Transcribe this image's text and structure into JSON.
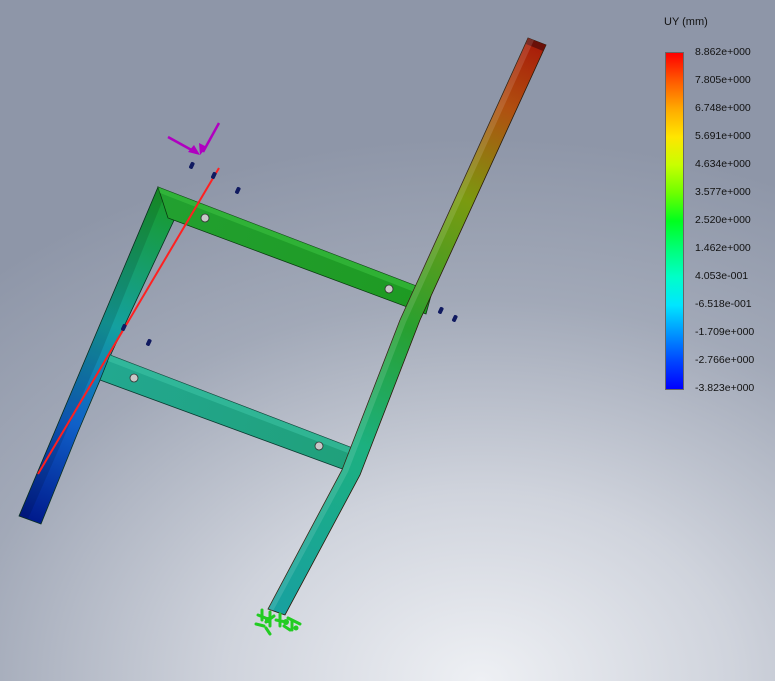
{
  "legend": {
    "title": "UY (mm)",
    "labels": [
      "8.862e+000",
      "7.805e+000",
      "6.748e+000",
      "5.691e+000",
      "4.634e+000",
      "3.577e+000",
      "2.520e+000",
      "1.462e+000",
      "4.053e-001",
      "-6.518e-001",
      "-1.709e+000",
      "-2.766e+000",
      "-3.823e+000"
    ],
    "colors": [
      "#ff0000",
      "#ff5a00",
      "#ffaa00",
      "#ffe600",
      "#c8ff00",
      "#6eff00",
      "#00ff1e",
      "#00ff78",
      "#00ffc8",
      "#00e6ff",
      "#0096ff",
      "#0046ff",
      "#0000ff"
    ]
  },
  "colors": {
    "background_center": "#eef0f4",
    "background_edge": "#8e96a8",
    "probe_line": "#ff2020",
    "load_arrow": "#b000c0",
    "fixture": "#22cc22",
    "marker": "#101a60"
  }
}
